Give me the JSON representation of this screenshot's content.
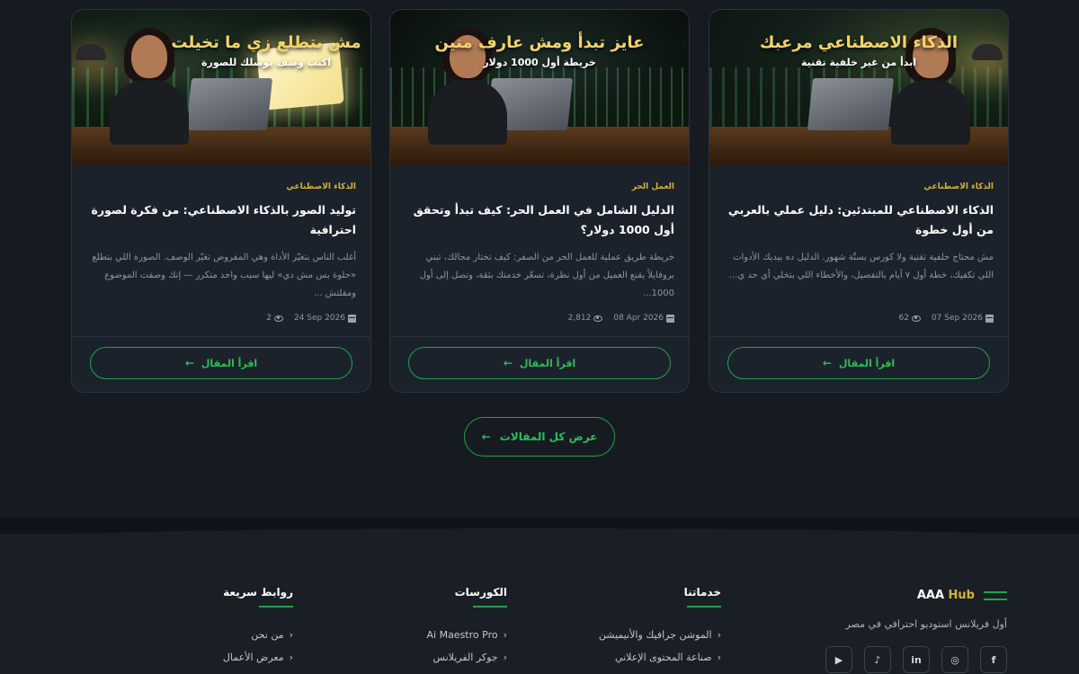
{
  "articles": [
    {
      "image_title": "الذكاء الاصطناعي مرعبك",
      "image_subtitle": "ابدأ من غير خلفية تقنية",
      "category": "الذكاء الاصطناعي",
      "title": "الذكاء الاصطناعي للمبتدئين: دليل عملي بالعربي من أول خطوة",
      "excerpt": "مش محتاج خلفية تقنية ولا كورس بستّة شهور. الدليل ده بيديك الأدوات اللي تكفيك، خطة أول ٧ أيام بالتفصيل، والأخطاء اللي بتخلي أي حد ي...",
      "date": "07 Sep 2026",
      "views": "62",
      "read_label": "اقرأ المقال"
    },
    {
      "image_title": "عايز تبدأ ومش عارف منين",
      "image_subtitle": "خريطة أول 1000 دولار",
      "category": "العمل الحر",
      "title": "الدليل الشامل في العمل الحر: كيف تبدأ وتحقق أول 1000 دولار؟",
      "excerpt": "خريطة طريق عملية للعمل الحر من الصفر: كيف تختار مجالك، تبني بروفايلاً يقنع العميل من أول نظرة، تسعّر خدمتك بثقة، وتصل إلى أول 1000...",
      "date": "08 Apr 2026",
      "views": "2,812",
      "read_label": "اقرأ المقال"
    },
    {
      "image_title": "مش بتطلع زي ما تخيلت",
      "image_subtitle": "اكتب وصف يوصلك للصورة",
      "category": "الذكاء الاصطناعي",
      "title": "توليد الصور بالذكاء الاصطناعي: من فكرة لصورة احترافية",
      "excerpt": "أغلب الناس بتغيّر الأداة وهي المفروض تغيّر الوصف. الصورة اللي بتطلع «حلوة بس مش دي» ليها سبب واحد متكرر — إنك وصفت الموضوع ومقلتش ...",
      "date": "24 Sep 2026",
      "views": "2",
      "read_label": "اقرأ المقال"
    }
  ],
  "all_articles_label": "عرض كل المقالات",
  "footer": {
    "brand_name_a": "AAA",
    "brand_name_b": "Hub",
    "tagline": "أول فريلانس استوديو احترافي في مصر",
    "services_title": "خدماتنا",
    "services": [
      "الموشن جرافيك والأنيميشن",
      "صناعة المحتوى الإعلاني"
    ],
    "courses_title": "الكورسات",
    "courses": [
      "Ai Maestro Pro",
      "جوكر الفريلانس"
    ],
    "links_title": "روابط سريعة",
    "links": [
      "من نحن",
      "معرض الأعمال"
    ],
    "socials": [
      "facebook-icon",
      "instagram-icon",
      "linkedin-icon",
      "tiktok-icon",
      "youtube-icon"
    ]
  },
  "colors": {
    "accent": "#1fa34a",
    "gold": "#d6b23c",
    "bg": "#161b22",
    "card": "#1c222b"
  }
}
